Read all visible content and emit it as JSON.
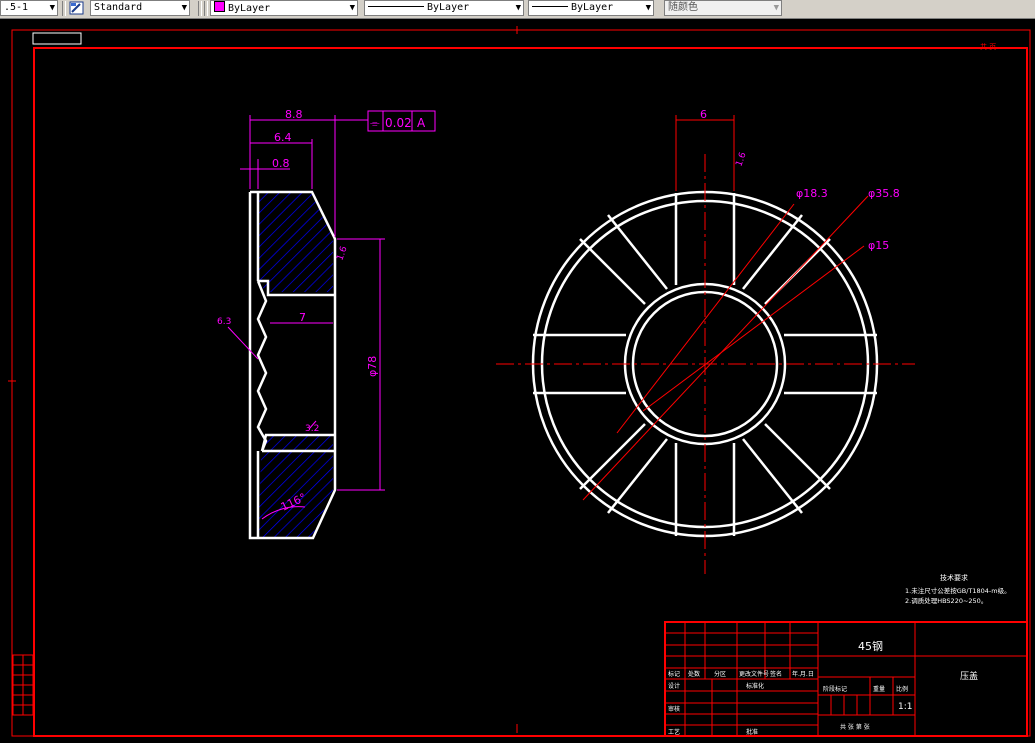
{
  "toolbar": {
    "scale_value": ".5-1",
    "text_style": "Standard",
    "color": "ByLayer",
    "linetype": "ByLayer",
    "lineweight": "ByLayer",
    "plot_style": "随颜色"
  },
  "colors": {
    "border": "#ff0000",
    "dimension": "#ff00ff",
    "hatch": "#0000ff",
    "outline": "#ffffff",
    "centerline": "#ff0000"
  },
  "drawing": {
    "tag_top_right": "共 页",
    "side_view": {
      "dim_8_8": "8.8",
      "dim_6_4": "6.4",
      "dim_0_8": "0.8",
      "tolerance_symbol": "⌯",
      "tolerance_value": "0.02",
      "tolerance_datum": "A",
      "dim_7": "7",
      "dim_phi78": "φ78",
      "roughness_left": "6.3",
      "roughness_right": "1.6",
      "roughness_bottom": "3.2",
      "angle": "116°"
    },
    "front_view": {
      "dim_6": "6",
      "roughness": "1.6",
      "phi_18_3": "φ18.3",
      "phi_35_8": "φ35.8",
      "phi_15": "φ15"
    },
    "notes": {
      "title": "技术要求",
      "line1": "1.未注尺寸公差按GB/T1804-m级。",
      "line2": "2.调质处理HBS220~250。"
    },
    "title_block": {
      "material": "45钢",
      "part_name": "压盖",
      "scale": "1:1",
      "cell_mark": "标记",
      "cell_count": "处数",
      "cell_zone": "分区",
      "cell_docno": "更改文件号",
      "cell_sign": "签名",
      "cell_date": "年.月.日",
      "cell_design": "设计",
      "cell_standard": "标准化",
      "cell_stage": "阶段标记",
      "cell_weight": "重量",
      "cell_ratio": "比例",
      "cell_review": "审核",
      "cell_process": "工艺",
      "cell_approve": "批准",
      "cell_sheets": "共 张 第 张"
    }
  }
}
